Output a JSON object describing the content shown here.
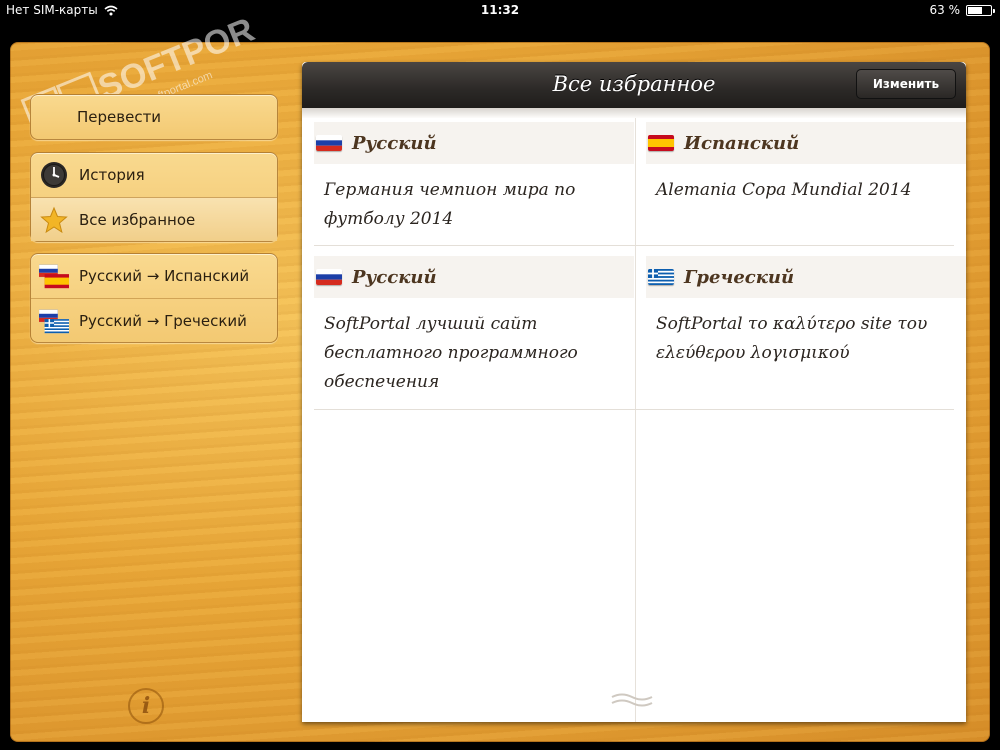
{
  "status_bar": {
    "carrier": "Нет SIM-карты",
    "time": "11:32",
    "battery": "63 %",
    "battery_level": 0.63
  },
  "watermark": {
    "text": "SOFTPORTAL",
    "subtext": "www.softportal.com"
  },
  "sidebar": {
    "translate_label": "Перевести",
    "history_label": "История",
    "favorites_label": "Все избранное",
    "pairs": [
      {
        "label": "Русский → Испанский",
        "from_flag": "russia-flag",
        "to_flag": "spain-flag"
      },
      {
        "label": "Русский → Греческий",
        "from_flag": "russia-flag",
        "to_flag": "greece-flag"
      }
    ],
    "info_label": "i"
  },
  "main": {
    "title": "Все избранное",
    "edit_label": "Изменить",
    "entries": [
      {
        "source_lang": "Русский",
        "source_flag": "russia-flag",
        "source_text": "Германия чемпион мира по футболу 2014",
        "target_lang": "Испанский",
        "target_flag": "spain-flag",
        "target_text": "Alemania Copa Mundial 2014"
      },
      {
        "source_lang": "Русский",
        "source_flag": "russia-flag",
        "source_text": "SoftPortal лучший сайт бесплатного программного обеспечения",
        "target_lang": "Греческий",
        "target_flag": "greece-flag",
        "target_text": "SoftPortal το καλύτερο site του ελεύθερου λογισμικού"
      }
    ]
  },
  "colors": {
    "wood": "#eaa838",
    "navbar": "#2c2927",
    "lang_text": "#4d3620",
    "accent_star": "#f2b526"
  }
}
